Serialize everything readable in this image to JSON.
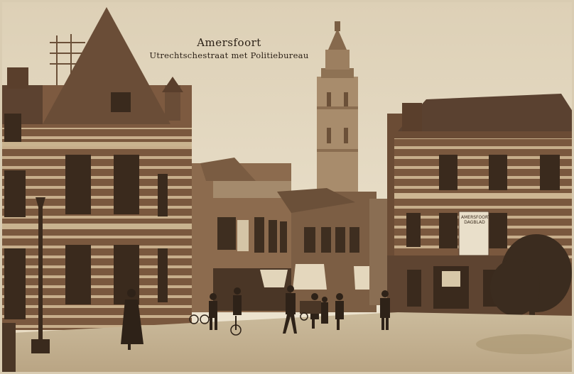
{
  "caption": {
    "city": "Amersfoort",
    "street": "Utrechtschestraat met Politiebureau"
  },
  "shop_sign": {
    "text": "AMERSFOORTSCH\nDAGBLAD"
  },
  "colors": {
    "sky": "#e6dcc8",
    "building_brick": "#7d5a40",
    "building_dark": "#5a3f2c",
    "road": "#c9b89a",
    "ink": "#2b2016"
  }
}
